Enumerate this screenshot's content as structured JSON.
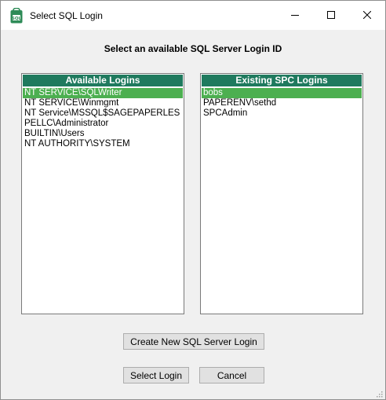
{
  "window": {
    "title": "Select SQL Login",
    "app_icon": "sql-app-icon",
    "controls": {
      "minimize": "minimize-icon",
      "maximize": "maximize-icon",
      "close": "close-icon"
    }
  },
  "header": {
    "text": "Select an available SQL Server Login ID"
  },
  "available_logins": {
    "title": "Available Logins",
    "selected_index": 0,
    "items": [
      "NT SERVICE\\SQLWriter",
      "NT SERVICE\\Winmgmt",
      "NT Service\\MSSQL$SAGEPAPERLES",
      "PELLC\\Administrator",
      "BUILTIN\\Users",
      "NT AUTHORITY\\SYSTEM"
    ]
  },
  "existing_logins": {
    "title": "Existing SPC Logins",
    "selected_index": 0,
    "items": [
      "bobs",
      "PAPERENV\\sethd",
      "SPCAdmin"
    ]
  },
  "buttons": {
    "create": "Create New SQL Server Login",
    "select": "Select Login",
    "cancel": "Cancel"
  },
  "colors": {
    "list_header_bg": "#1f7a5e",
    "selection_bg": "#4caf50"
  }
}
